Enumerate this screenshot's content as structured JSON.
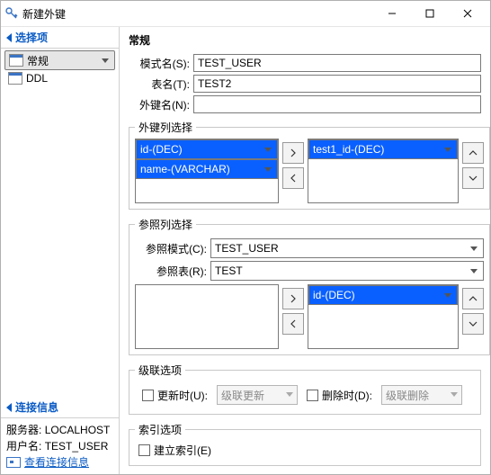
{
  "window": {
    "title": "新建外键"
  },
  "left": {
    "optionsHeader": "选择项",
    "items": [
      "常规",
      "DDL"
    ],
    "connHeader": "连接信息",
    "serverLabel": "服务器:",
    "serverValue": "LOCALHOST",
    "userLabel": "用户名:",
    "userValue": "TEST_USER",
    "connLink": "查看连接信息"
  },
  "main": {
    "header": "常规",
    "schemaLabel": "模式名(S):",
    "schemaValue": "TEST_USER",
    "tableLabel": "表名(T):",
    "tableValue": "TEST2",
    "fkLabel": "外键名(N):",
    "fkValue": "",
    "fkColsLabel": "外键列选择",
    "leftList": [
      "id-(DEC)",
      "name-(VARCHAR)"
    ],
    "rightList": [
      "test1_id-(DEC)"
    ],
    "refColsLabel": "参照列选择",
    "refSchemaLabel": "参照模式(C):",
    "refSchemaValue": "TEST_USER",
    "refTableLabel": "参照表(R):",
    "refTableValue": "TEST",
    "refRightList": [
      "id-(DEC)"
    ],
    "cascadeLabel": "级联选项",
    "onUpdate": "更新时(U):",
    "onUpdateVal": "级联更新",
    "onDelete": "删除时(D):",
    "onDeleteVal": "级联删除",
    "indexLabel": "索引选项",
    "createIndex": "建立索引(E)"
  }
}
